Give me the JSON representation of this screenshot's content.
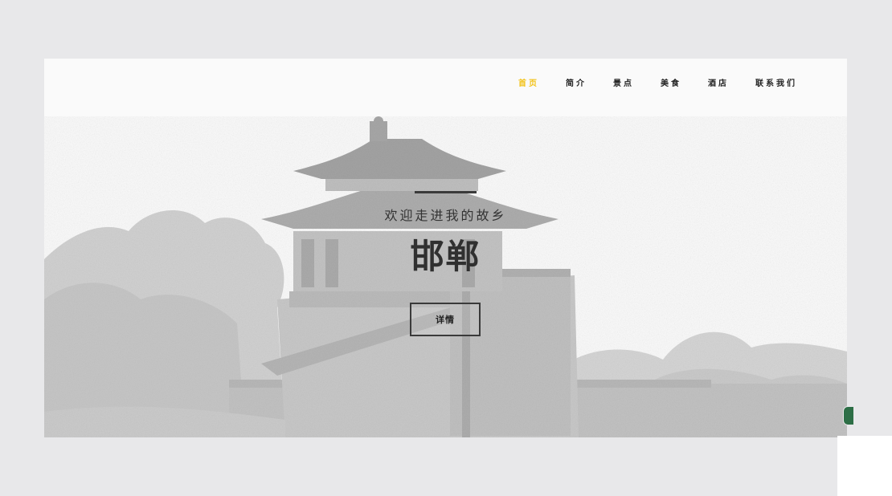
{
  "nav": {
    "items": [
      {
        "label": "首页",
        "active": true
      },
      {
        "label": "简介",
        "active": false
      },
      {
        "label": "景点",
        "active": false
      },
      {
        "label": "美食",
        "active": false
      },
      {
        "label": "酒店",
        "active": false
      },
      {
        "label": "联系我们",
        "active": false
      }
    ],
    "active_color": "#f2c21a"
  },
  "hero": {
    "subtitle": "欢迎走进我的故乡",
    "title": "邯郸",
    "button_label": "详情",
    "image_icon": "ancient-tower-photo"
  }
}
